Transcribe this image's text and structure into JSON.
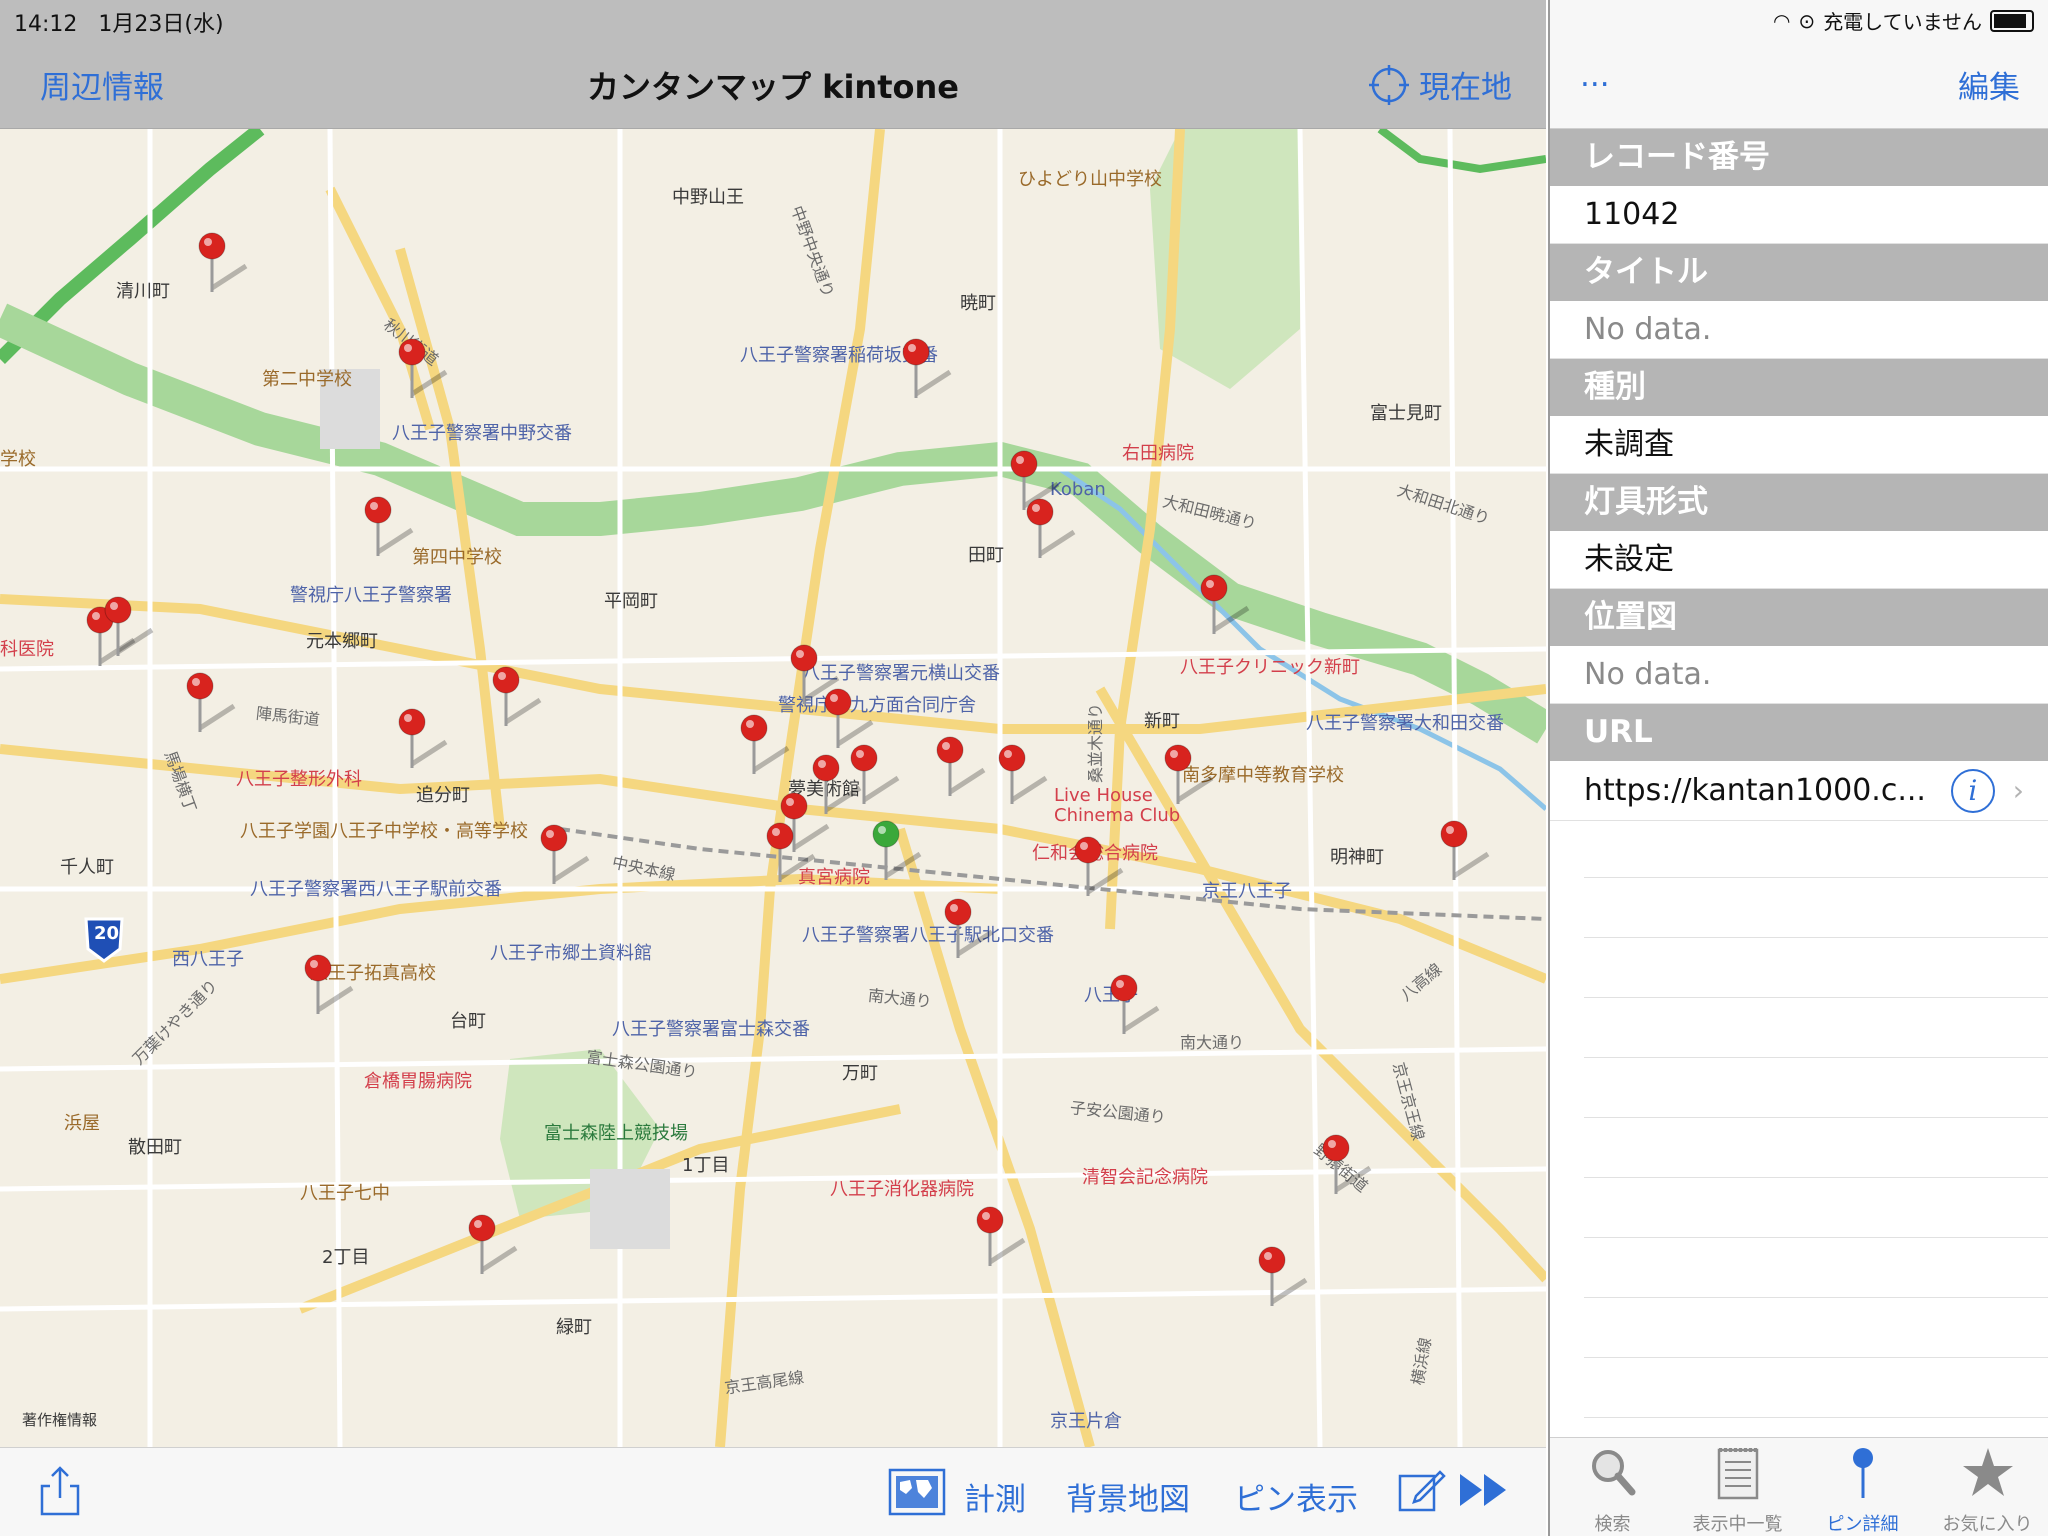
{
  "status": {
    "time": "14:12",
    "date": "1月23日(水)",
    "battery_text": "充電していません"
  },
  "nav": {
    "left": "周辺情報",
    "title": "カンタンマップ kintone",
    "right": "現在地"
  },
  "map_labels": [
    {
      "text": "中野山王",
      "type": "place"
    },
    {
      "text": "ひよどり山中学校",
      "type": "school"
    },
    {
      "text": "清川町",
      "type": "place"
    },
    {
      "text": "暁町",
      "type": "place"
    },
    {
      "text": "秋川街道",
      "type": "street"
    },
    {
      "text": "第二中学校",
      "type": "school"
    },
    {
      "text": "八王子警察署稲荷坂交番",
      "type": "police"
    },
    {
      "text": "八王子警察署中野交番",
      "type": "police"
    },
    {
      "text": "富士見町",
      "type": "place"
    },
    {
      "text": "右田病院",
      "type": "hosp"
    },
    {
      "text": "Koban",
      "type": "police"
    },
    {
      "text": "学校",
      "type": "school"
    },
    {
      "text": "第四中学校",
      "type": "school"
    },
    {
      "text": "田町",
      "type": "place"
    },
    {
      "text": "警視庁八王子警察署",
      "type": "police"
    },
    {
      "text": "平岡町",
      "type": "place"
    },
    {
      "text": "元本郷町",
      "type": "place"
    },
    {
      "text": "八王子クリニック新町",
      "type": "hosp"
    },
    {
      "text": "科医院",
      "type": "hosp"
    },
    {
      "text": "八王子警察署元横山交番",
      "type": "police"
    },
    {
      "text": "警視庁第九方面合同庁舎",
      "type": "police"
    },
    {
      "text": "陣馬街道",
      "type": "street"
    },
    {
      "text": "新町",
      "type": "place"
    },
    {
      "text": "八王子警察署大和田交番",
      "type": "police"
    },
    {
      "text": "八王子整形外科",
      "type": "hosp"
    },
    {
      "text": "追分町",
      "type": "place"
    },
    {
      "text": "夢美術館",
      "type": "place"
    },
    {
      "text": "Live House",
      "type": "hosp"
    },
    {
      "text": "Chinema Club",
      "type": "hosp"
    },
    {
      "text": "南多摩中等教育学校",
      "type": "school"
    },
    {
      "text": "八王子学園八王子中学校・高等学校",
      "type": "school"
    },
    {
      "text": "仁和会総合病院",
      "type": "hosp"
    },
    {
      "text": "千人町",
      "type": "place"
    },
    {
      "text": "中央本線",
      "type": "street"
    },
    {
      "text": "真宮病院",
      "type": "hosp"
    },
    {
      "text": "明神町",
      "type": "place"
    },
    {
      "text": "京王八王子",
      "type": "police"
    },
    {
      "text": "八王子警察署西八王子駅前交番",
      "type": "police"
    },
    {
      "text": "八王子警察署八王子駅北口交番",
      "type": "police"
    },
    {
      "text": "西八王子",
      "type": "police"
    },
    {
      "text": "八王子市郷土資料館",
      "type": "police"
    },
    {
      "text": "八王子拓真高校",
      "type": "school"
    },
    {
      "text": "南大通り",
      "type": "street"
    },
    {
      "text": "八王子",
      "type": "police"
    },
    {
      "text": "台町",
      "type": "place"
    },
    {
      "text": "八王子警察署富士森交番",
      "type": "police"
    },
    {
      "text": "万町",
      "type": "place"
    },
    {
      "text": "倉橋胃腸病院",
      "type": "hosp"
    },
    {
      "text": "富士森公園通り",
      "type": "street"
    },
    {
      "text": "子安公園通り",
      "type": "street"
    },
    {
      "text": "富士森陸上競技場",
      "type": "park"
    },
    {
      "text": "浜屋",
      "type": "school"
    },
    {
      "text": "散田町",
      "type": "place"
    },
    {
      "text": "1丁目",
      "type": "place"
    },
    {
      "text": "八王子消化器病院",
      "type": "hosp"
    },
    {
      "text": "清智会記念病院",
      "type": "hosp"
    },
    {
      "text": "八王子七中",
      "type": "school"
    },
    {
      "text": "野猿街道",
      "type": "street"
    },
    {
      "text": "2丁目",
      "type": "place"
    },
    {
      "text": "緑町",
      "type": "place"
    },
    {
      "text": "京王高尾線",
      "type": "street"
    },
    {
      "text": "京王片倉",
      "type": "police"
    },
    {
      "text": "著作権情報",
      "type": "place"
    },
    {
      "text": "桑並木通り",
      "type": "street"
    },
    {
      "text": "大和田暁通り",
      "type": "street"
    },
    {
      "text": "大和田北通り",
      "type": "street"
    },
    {
      "text": "中野中央通り",
      "type": "street"
    },
    {
      "text": "馬場横丁",
      "type": "street"
    },
    {
      "text": "万葉けやき通り",
      "type": "street"
    },
    {
      "text": "八高線",
      "type": "street"
    },
    {
      "text": "京王京王線",
      "type": "street"
    },
    {
      "text": "横浜線",
      "type": "street"
    },
    {
      "text": "南大通り",
      "type": "street"
    }
  ],
  "route_badge": "20",
  "bottom": {
    "measure": "計測",
    "background_map": "背景地図",
    "pin_display": "ピン表示"
  },
  "right": {
    "more": "...",
    "edit": "編集",
    "fields": [
      {
        "label": "レコード番号",
        "value": "11042",
        "nodata": false
      },
      {
        "label": "タイトル",
        "value": "No data.",
        "nodata": true
      },
      {
        "label": "種別",
        "value": "未調査",
        "nodata": false
      },
      {
        "label": "灯具形式",
        "value": "未設定",
        "nodata": false
      },
      {
        "label": "位置図",
        "value": "No data.",
        "nodata": true
      }
    ],
    "url_label": "URL",
    "url_value": "https://kantan1000.c..."
  },
  "tabs": [
    {
      "label": "検索",
      "icon": "magnifier-icon",
      "active": false
    },
    {
      "label": "表示中一覧",
      "icon": "notepad-icon",
      "active": false
    },
    {
      "label": "ピン詳細",
      "icon": "pin-icon",
      "active": true
    },
    {
      "label": "お気に入り",
      "icon": "star-icon",
      "active": false
    }
  ],
  "colors": {
    "accent": "#2f6fd6",
    "pin_red": "#d8231e",
    "pin_green": "#3aa83a",
    "river": "#a7d79a",
    "header_gray": "#b5b5b5"
  }
}
